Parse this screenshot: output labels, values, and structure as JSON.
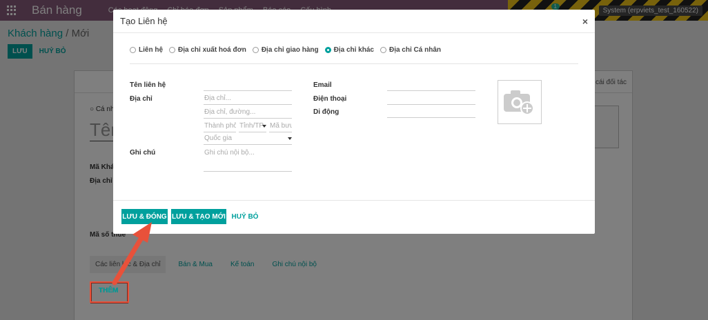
{
  "app": {
    "name": "Bán hàng",
    "menu": [
      "Các hoạt động",
      "Chỉ báo đơn",
      "Sản phẩm",
      "Báo cáo",
      "Cấu hình"
    ],
    "user": "System (erpviets_test_160522)",
    "notification_count": "1"
  },
  "background": {
    "breadcrumb_parent": "Khách hàng",
    "breadcrumb_sep": "/",
    "breadcrumb_current": "Mới",
    "save_label": "LƯU",
    "discard_label": "HUỶ BỎ",
    "partner_label": "cái đối tác",
    "radio_individual": "Cá nhân",
    "name_placeholder": "Tên",
    "field_code": "Mã Khách",
    "field_address": "Địa chỉ c",
    "field_tax": "Mã số thuế",
    "tabs": [
      "Các liên lạc & Địa chỉ",
      "Bán & Mua",
      "Kế toán",
      "Ghi chú nội bộ"
    ],
    "add_label": "THÊM"
  },
  "modal": {
    "title": "Tạo Liên hệ",
    "close_symbol": "×",
    "types": [
      {
        "label": "Liên hệ",
        "checked": false
      },
      {
        "label": "Địa chỉ xuất hoá đơn",
        "checked": false
      },
      {
        "label": "Địa chỉ giao hàng",
        "checked": false
      },
      {
        "label": "Địa chỉ khác",
        "checked": true
      },
      {
        "label": "Địa chỉ Cá nhân",
        "checked": false
      }
    ],
    "labels": {
      "contact_name": "Tên liên hệ",
      "address": "Địa chỉ",
      "note": "Ghi chú",
      "email": "Email",
      "phone": "Điện thoại",
      "mobile": "Di động"
    },
    "placeholders": {
      "address_line1": "Địa chỉ...",
      "address_line2": "Địa chỉ, đường...",
      "city": "Thành phố",
      "state": "Tỉnh/TP",
      "zip": "Mã bưu",
      "country": "Quốc gia",
      "note": "Ghi chú nội bộ..."
    },
    "buttons": {
      "save_close": "LƯU & ĐÓNG",
      "save_new": "LƯU & TẠO MỚI",
      "discard": "HUỶ BỎ"
    }
  },
  "colors": {
    "brand": "#875a7b",
    "accent": "#00a09d",
    "annotation": "#e8513a"
  }
}
